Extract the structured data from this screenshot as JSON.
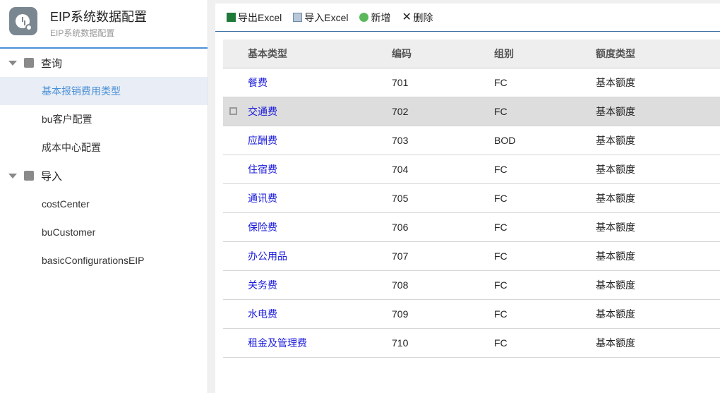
{
  "app": {
    "title": "EIP系统数据配置",
    "subtitle": "EIP系统数据配置"
  },
  "sidebar": {
    "groups": [
      {
        "label": "查询",
        "icon": "search-doc-icon",
        "items": [
          "基本报销费用类型",
          "bu客户配置",
          "成本中心配置"
        ]
      },
      {
        "label": "导入",
        "icon": "import-icon",
        "items": [
          "costCenter",
          "buCustomer",
          "basicConfigurationsEIP"
        ]
      }
    ]
  },
  "toolbar": {
    "export": "导出Excel",
    "import": "导入Excel",
    "add": "新增",
    "delete": "删除"
  },
  "table": {
    "headers": [
      "基本类型",
      "编码",
      "组别",
      "额度类型"
    ],
    "rows": [
      [
        "餐费",
        "701",
        "FC",
        "基本额度"
      ],
      [
        "交通费",
        "702",
        "FC",
        "基本额度"
      ],
      [
        "应酬费",
        "703",
        "BOD",
        "基本额度"
      ],
      [
        "住宿费",
        "704",
        "FC",
        "基本额度"
      ],
      [
        "通讯费",
        "705",
        "FC",
        "基本额度"
      ],
      [
        "保险费",
        "706",
        "FC",
        "基本额度"
      ],
      [
        "办公用品",
        "707",
        "FC",
        "基本额度"
      ],
      [
        "关务费",
        "708",
        "FC",
        "基本额度"
      ],
      [
        "水电费",
        "709",
        "FC",
        "基本额度"
      ],
      [
        "租金及管理费",
        "710",
        "FC",
        "基本额度"
      ]
    ]
  }
}
